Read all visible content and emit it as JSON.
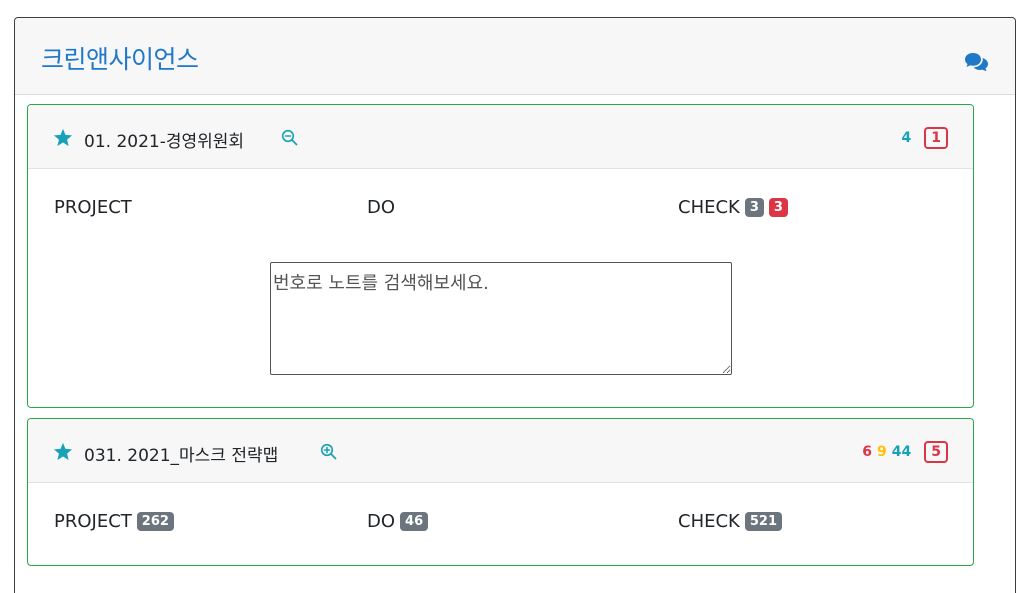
{
  "app": {
    "title": "크린앤사이언스",
    "chat_icon": "comments-icon"
  },
  "colors": {
    "brand_blue": "#1f78c8",
    "card_border_green": "#28a745",
    "teal": "#17a2b8",
    "red": "#dc3545",
    "yellow": "#ffc107",
    "badge_gray": "#6c757d"
  },
  "cards": [
    {
      "title": "01. 2021-경영위원회",
      "star_icon": "star-icon",
      "zoom_icon": "zoom-out-icon",
      "stats": {
        "teal": "4",
        "boxed": "1"
      },
      "columns": {
        "project_label": "PROJECT",
        "do_label": "DO",
        "check_label": "CHECK",
        "check_badge_gray": "3",
        "check_badge_red": "3"
      },
      "search": {
        "placeholder": "번호로 노트를 검색해보세요."
      }
    },
    {
      "title": "031. 2021_마스크 전략맵",
      "star_icon": "star-icon",
      "zoom_icon": "zoom-in-icon",
      "stats": {
        "red": "6",
        "yellow": "9",
        "teal": "44",
        "boxed": "5"
      },
      "columns": {
        "project_label": "PROJECT",
        "project_badge": "262",
        "do_label": "DO",
        "do_badge": "46",
        "check_label": "CHECK",
        "check_badge": "521"
      }
    }
  ]
}
